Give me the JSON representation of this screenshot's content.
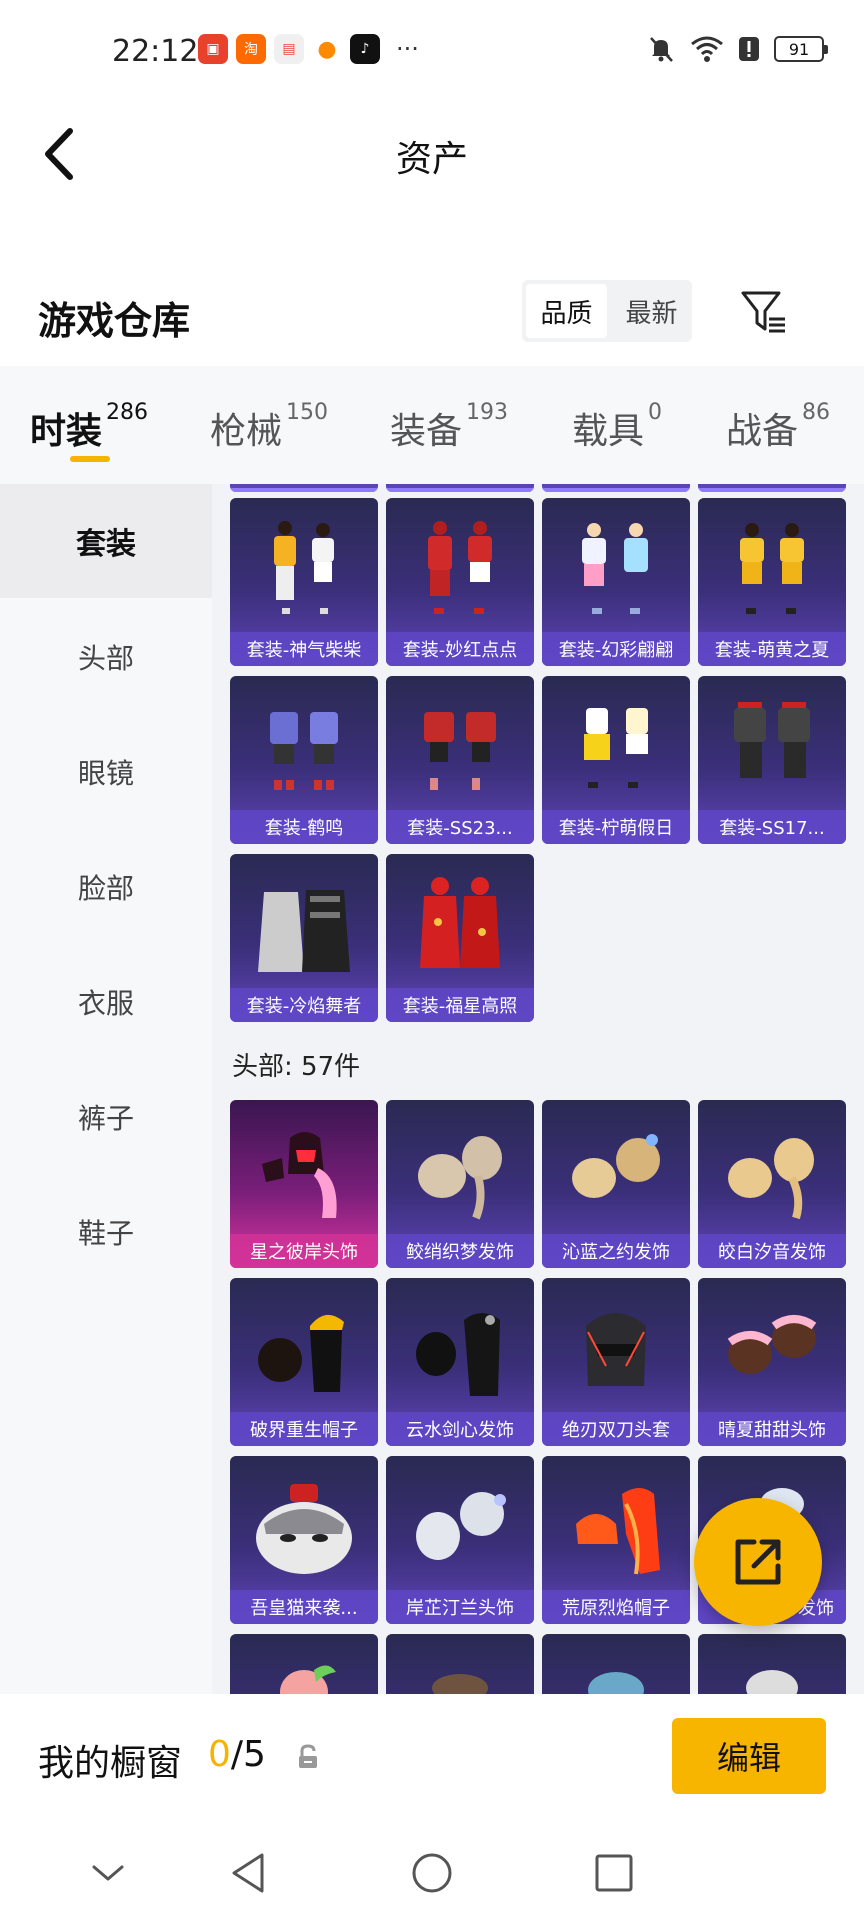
{
  "status_bar": {
    "time": "22:12",
    "battery": "91",
    "overflow": "···"
  },
  "header": {
    "title": "资产"
  },
  "section": {
    "title": "游戏仓库",
    "sort_quality": "品质",
    "sort_latest": "最新"
  },
  "tabs": [
    {
      "label": "时装",
      "count": "286"
    },
    {
      "label": "枪械",
      "count": "150"
    },
    {
      "label": "装备",
      "count": "193"
    },
    {
      "label": "载具",
      "count": "0"
    },
    {
      "label": "战备",
      "count": "86"
    }
  ],
  "sidebar": {
    "items": [
      {
        "label": "套装"
      },
      {
        "label": "头部"
      },
      {
        "label": "眼镜"
      },
      {
        "label": "脸部"
      },
      {
        "label": "衣服"
      },
      {
        "label": "裤子"
      },
      {
        "label": "鞋子"
      }
    ]
  },
  "suits": [
    {
      "label": "套装-神气柴柴"
    },
    {
      "label": "套装-妙红点点"
    },
    {
      "label": "套装-幻彩翩翩"
    },
    {
      "label": "套装-萌黄之夏"
    },
    {
      "label": "套装-鹤鸣"
    },
    {
      "label": "套装-SS23..."
    },
    {
      "label": "套装-柠萌假日"
    },
    {
      "label": "套装-SS17..."
    },
    {
      "label": "套装-冷焰舞者"
    },
    {
      "label": "套装-福星高照"
    }
  ],
  "head_group": {
    "label": "头部: 57件"
  },
  "heads": [
    {
      "label": "星之彼岸头饰"
    },
    {
      "label": "鲛绡织梦发饰"
    },
    {
      "label": "沁蓝之约发饰"
    },
    {
      "label": "皎白汐音发饰"
    },
    {
      "label": "破界重生帽子"
    },
    {
      "label": "云水剑心发饰"
    },
    {
      "label": "绝刃双刀头套"
    },
    {
      "label": "晴夏甜甜头饰"
    },
    {
      "label": "吾皇猫来袭..."
    },
    {
      "label": "岸芷汀兰头饰"
    },
    {
      "label": "荒原烈焰帽子"
    },
    {
      "label": "发饰"
    }
  ],
  "showcase": {
    "label": "我的橱窗",
    "current": "0",
    "total": "/5",
    "edit_label": "编辑"
  }
}
